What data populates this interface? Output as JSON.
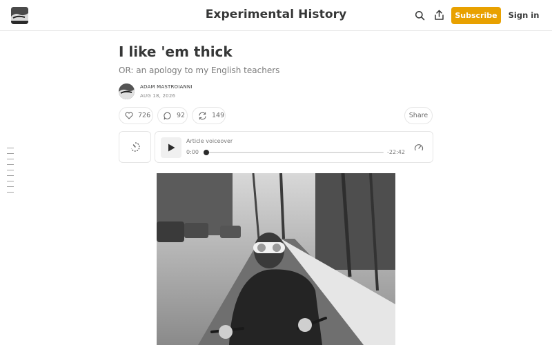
{
  "header": {
    "site_title": "Experimental History",
    "subscribe_label": "Subscribe",
    "signin_label": "Sign in",
    "accent_color": "#e8a100"
  },
  "post": {
    "title": "I like 'em thick",
    "subtitle": "OR: an apology to my English teachers",
    "author": "ADAM MASTROIANNI",
    "date": "AUG 18, 2026"
  },
  "actions": {
    "likes": "726",
    "comments": "92",
    "restacks": "149",
    "share_label": "Share"
  },
  "audio": {
    "label": "Article voiceover",
    "current_time": "0:00",
    "remaining_time": "-22:42",
    "progress": 0
  },
  "icons": [
    "logo",
    "search-icon",
    "share-icon",
    "heart-icon",
    "comment-icon",
    "restack-icon",
    "speed-icon",
    "play-icon",
    "speedometer-icon"
  ]
}
